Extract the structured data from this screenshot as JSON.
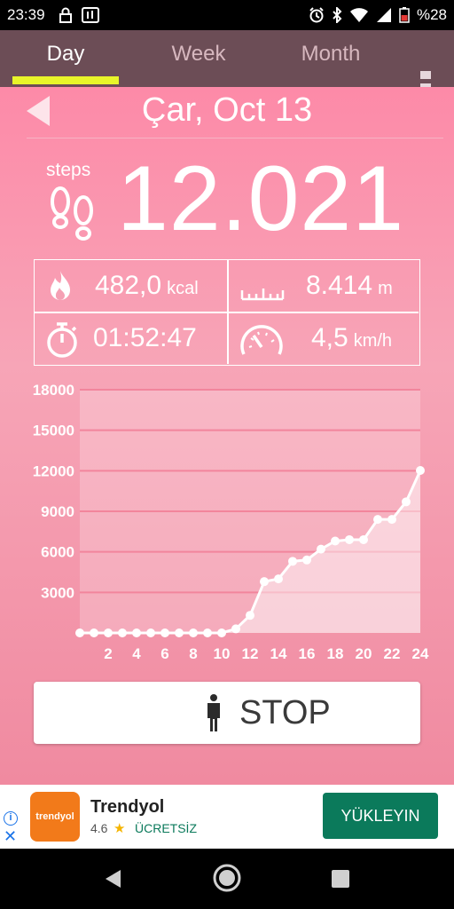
{
  "status_bar": {
    "time": "23:39",
    "battery": "%28"
  },
  "tabs": [
    {
      "label": "Day"
    },
    {
      "label": "Week"
    },
    {
      "label": "Month"
    }
  ],
  "header": {
    "date": "Çar, Oct 13"
  },
  "steps": {
    "label": "steps",
    "value": "12.021"
  },
  "stats": {
    "calories": {
      "value": "482,0",
      "unit": "kcal"
    },
    "distance": {
      "value": "8.414",
      "unit": "m"
    },
    "duration": {
      "value": "01:52:47"
    },
    "speed": {
      "value": "4,5",
      "unit": "km/h"
    }
  },
  "stop_button": {
    "label": "STOP"
  },
  "ad": {
    "title": "Trendyol",
    "logo_text": "trendyol",
    "rating": "4.6",
    "price": "ÜCRETSİZ",
    "cta": "YÜKLEYIN",
    "info": "i",
    "close": "✕"
  },
  "colors": {
    "tab_bar": "#6c4d56",
    "tab_indicator": "#e8f52a",
    "background": "#f7a5b7",
    "install_button": "#0b7a5b"
  },
  "chart_data": {
    "type": "line",
    "x": [
      0,
      1,
      2,
      3,
      4,
      5,
      6,
      7,
      8,
      9,
      10,
      11,
      12,
      13,
      14,
      15,
      16,
      17,
      18,
      19,
      20,
      21,
      22,
      23,
      24
    ],
    "x_tick_labels": [
      "2",
      "4",
      "6",
      "8",
      "10",
      "12",
      "14",
      "16",
      "18",
      "20",
      "22",
      "24"
    ],
    "y_tick_labels": [
      "3000",
      "6000",
      "9000",
      "12000",
      "15000",
      "18000"
    ],
    "values": [
      0,
      0,
      0,
      0,
      0,
      0,
      0,
      0,
      0,
      0,
      0,
      300,
      1300,
      3800,
      4000,
      5300,
      5400,
      6200,
      6800,
      6900,
      6900,
      8400,
      8400,
      9700,
      12021
    ],
    "xlim": [
      0,
      24
    ],
    "ylim": [
      0,
      18000
    ],
    "grid": true
  }
}
